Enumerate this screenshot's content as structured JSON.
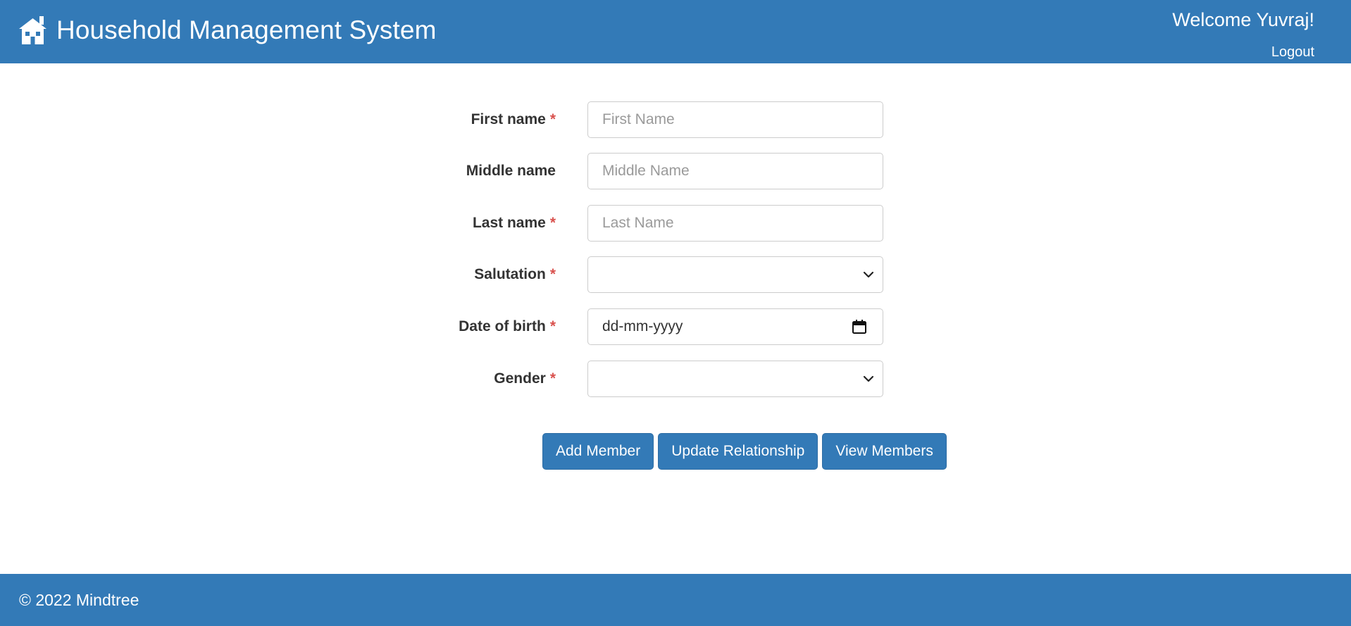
{
  "header": {
    "app_title": "Household Management System",
    "welcome_text": "Welcome Yuvraj!",
    "logout_label": "Logout",
    "brand_icon": "house-icon"
  },
  "form": {
    "first_name": {
      "label": "First name",
      "required_mark": "*",
      "placeholder": "First Name",
      "value": ""
    },
    "middle_name": {
      "label": "Middle name",
      "placeholder": "Middle Name",
      "value": ""
    },
    "last_name": {
      "label": "Last name",
      "required_mark": "*",
      "placeholder": "Last Name",
      "value": ""
    },
    "salutation": {
      "label": "Salutation",
      "required_mark": "*",
      "selected": "",
      "icon": "chevron-down-icon"
    },
    "date_of_birth": {
      "label": "Date of birth",
      "required_mark": "*",
      "display_value": "dd-mm-yyyy",
      "icon": "calendar-icon"
    },
    "gender": {
      "label": "Gender",
      "required_mark": "*",
      "selected": "",
      "icon": "chevron-down-icon"
    }
  },
  "actions": {
    "add_member_label": "Add Member",
    "update_relationship_label": "Update Relationship",
    "view_members_label": "View Members"
  },
  "footer": {
    "copyright": "© 2022 Mindtree"
  },
  "colors": {
    "brand": "#337ab7",
    "required": "#d9534f",
    "text": "#333333",
    "input_border": "#cccccc"
  }
}
